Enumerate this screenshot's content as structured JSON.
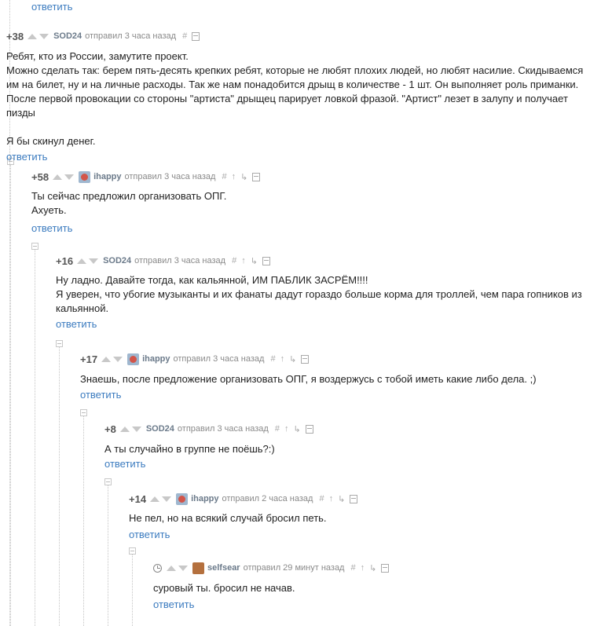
{
  "top_reply_label": "ответить",
  "comments": [
    {
      "score": "+38",
      "author": "SOD24",
      "posted": "отправил 3 часа назад",
      "hash": "#",
      "body": [
        "Ребят, кто из России, замутите проект.",
        "Можно сделать так: берем пять-десять крепких ребят, которые не любят плохих людей, но любят насилие. Скидываемся им на билет, ну и на личные расходы. Так же нам понадобится дрыщ в количестве - 1 шт. Он выполняет роль приманки. После первой провокации со стороны \"артиста\" дрыщец парирует ловкой фразой. \"Артист\" лезет в залупу и получает пизды",
        "Я бы скинул денег."
      ],
      "reply": "ответить"
    },
    {
      "score": "+58",
      "author": "ihappy",
      "posted": "отправил 3 часа назад",
      "hash": "#",
      "body": [
        "Ты сейчас предложил организовать ОПГ.",
        "Ахуеть."
      ],
      "reply": "ответить"
    },
    {
      "score": "+16",
      "author": "SOD24",
      "posted": "отправил 3 часа назад",
      "hash": "#",
      "body": [
        "Ну ладно. Давайте тогда, как кальянной, ИМ ПАБЛИК ЗАСРЁМ!!!!",
        "Я уверен, что убогие музыканты и их фанаты дадут гораздо больше корма для троллей, чем пара гопников из кальянной."
      ],
      "reply": "ответить"
    },
    {
      "score": "+17",
      "author": "ihappy",
      "posted": "отправил 3 часа назад",
      "hash": "#",
      "body": [
        "Знаешь, после предложение организовать ОПГ, я воздержусь с тобой иметь какие либо дела. ;)"
      ],
      "reply": "ответить"
    },
    {
      "score": "+8",
      "author": "SOD24",
      "posted": "отправил 3 часа назад",
      "hash": "#",
      "body": [
        "А ты случайно в группе не поёшь?:)"
      ],
      "reply": "ответить"
    },
    {
      "score": "+14",
      "author": "ihappy",
      "posted": "отправил 2 часа назад",
      "hash": "#",
      "body": [
        "Не пел, но на всякий случай бросил петь."
      ],
      "reply": "ответить"
    },
    {
      "score": "",
      "author": "selfsear",
      "posted": "отправил 29 минут назад",
      "hash": "#",
      "body": [
        "суровый ты. бросил не начав."
      ],
      "reply": "ответить"
    }
  ]
}
